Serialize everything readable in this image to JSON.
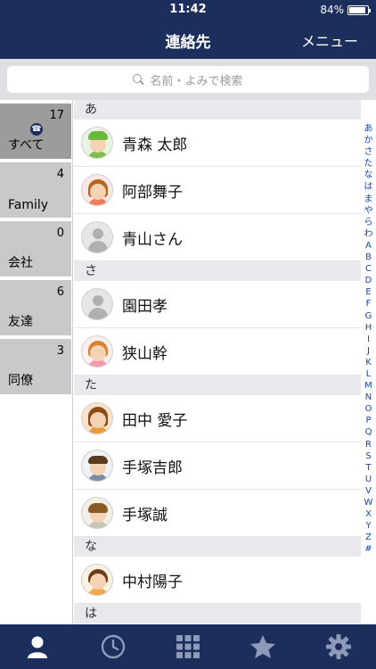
{
  "status": {
    "time": "11:42",
    "battery": "84%",
    "battery_level": 0.84
  },
  "nav": {
    "title": "連絡先",
    "menu": "メニュー"
  },
  "search": {
    "placeholder": "名前・よみで検索"
  },
  "groups": [
    {
      "name": "すべて",
      "count": "17",
      "selected": true
    },
    {
      "name": "Family",
      "count": "4"
    },
    {
      "name": "会社",
      "count": "0"
    },
    {
      "name": "友達",
      "count": "6"
    },
    {
      "name": "同僚",
      "count": "3"
    }
  ],
  "sections": [
    {
      "header": "あ",
      "contacts": [
        "青森 太郎",
        "阿部舞子",
        "青山さん"
      ]
    },
    {
      "header": "さ",
      "contacts": [
        "園田孝",
        "狭山幹"
      ]
    },
    {
      "header": "た",
      "contacts": [
        "田中 愛子",
        "手塚吉郎",
        "手塚誠"
      ]
    },
    {
      "header": "な",
      "contacts": [
        "中村陽子"
      ]
    },
    {
      "header": "は",
      "contacts": []
    }
  ],
  "index": [
    "あ",
    "か",
    "さ",
    "た",
    "な",
    "は",
    "ま",
    "や",
    "ら",
    "わ",
    "A",
    "B",
    "C",
    "D",
    "E",
    "F",
    "G",
    "H",
    "I",
    "J",
    "K",
    "L",
    "M",
    "N",
    "O",
    "P",
    "Q",
    "R",
    "S",
    "T",
    "U",
    "V",
    "W",
    "X",
    "Y",
    "Z",
    "#"
  ],
  "colors": {
    "nav": "#1b2e5c",
    "index": "#1a47a8"
  }
}
